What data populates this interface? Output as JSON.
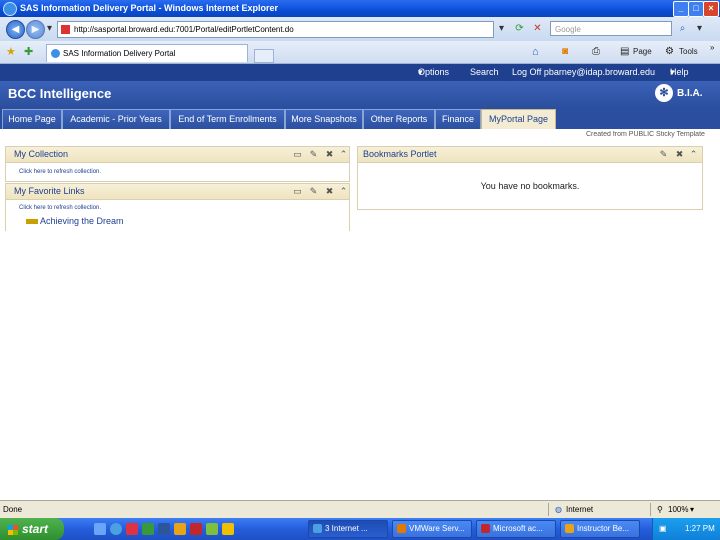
{
  "window": {
    "title": "SAS Information Delivery Portal - Windows Internet Explorer",
    "minimize": "_",
    "maximize": "□",
    "close": "×"
  },
  "addressbar": {
    "url": "http://sasportal.broward.edu:7001/Portal/editPortletContent.do",
    "search_placeholder": "Google"
  },
  "browser_tabs": {
    "active_tab": "SAS Information Delivery Portal",
    "commands": {
      "page": "Page",
      "tools": "Tools",
      "more": "»"
    }
  },
  "portal": {
    "topnav": {
      "options": "Options",
      "search": "Search",
      "logoff": "Log Off pbarney@idap.broward.edu",
      "help": "Help"
    },
    "brand": "BCC Intelligence",
    "logo_text": "B.I.A.",
    "nav_tabs": [
      "Home Page",
      "Academic - Prior Years",
      "End of Term Enrollments",
      "More Snapshots",
      "Other Reports",
      "Finance",
      "MyPortal Page"
    ],
    "active_tab_index": 6,
    "created_from": "Created from PUBLIC Sticky Template",
    "portlets": {
      "my_collection": {
        "title": "My Collection",
        "refresh": "Click here to refresh collection."
      },
      "my_favorite_links": {
        "title": "My Favorite Links",
        "refresh": "Click here to refresh collection.",
        "links": [
          "Achieving the Dream"
        ]
      },
      "bookmarks": {
        "title": "Bookmarks Portlet",
        "empty_message": "You have no bookmarks."
      }
    }
  },
  "statusbar": {
    "status": "Done",
    "zone": "Internet",
    "zoom": "100%"
  },
  "taskbar": {
    "start": "start",
    "tasks": [
      "3 Internet ...",
      "VMWare Serv...",
      "Microsoft ac...",
      "Instructor Be..."
    ],
    "clock": "1:27 PM"
  },
  "colors": {
    "portal_blue": "#2b4f9e",
    "portlet_header": "#efe4bf",
    "link": "#1f3f8f"
  }
}
